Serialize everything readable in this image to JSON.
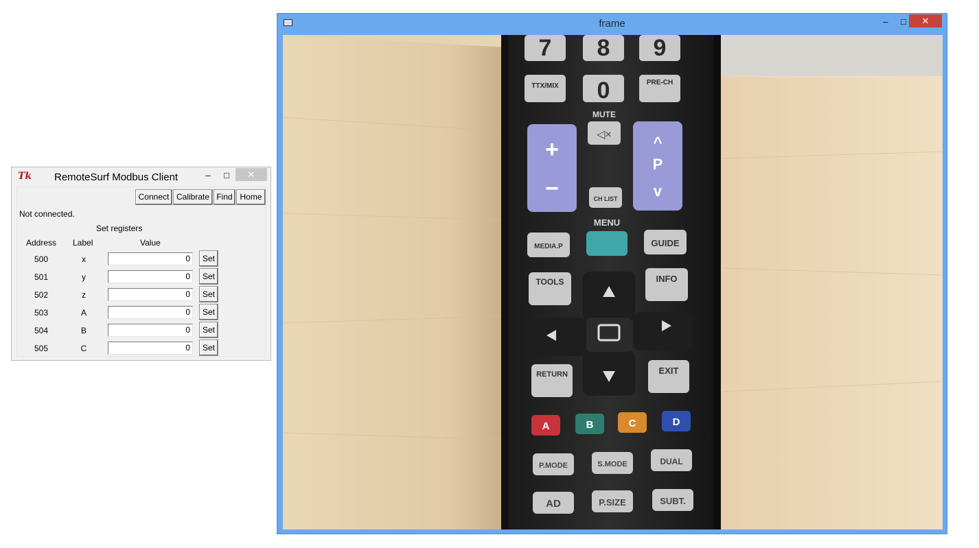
{
  "tk_window": {
    "title": "RemoteSurf Modbus Client",
    "logo": "Tk",
    "controls": {
      "minimize": "–",
      "maximize": "□",
      "close": "✕"
    },
    "toolbar": [
      "Connect",
      "Calibrate",
      "Find",
      "Home"
    ],
    "status": "Not connected.",
    "registers_title": "Set registers",
    "headers": {
      "address": "Address",
      "label": "Label",
      "value": "Value"
    },
    "rows": [
      {
        "address": "500",
        "label": "x",
        "value": "0",
        "button": "Set"
      },
      {
        "address": "501",
        "label": "y",
        "value": "0",
        "button": "Set"
      },
      {
        "address": "502",
        "label": "z",
        "value": "0",
        "button": "Set"
      },
      {
        "address": "503",
        "label": "A",
        "value": "0",
        "button": "Set"
      },
      {
        "address": "504",
        "label": "B",
        "value": "0",
        "button": "Set"
      },
      {
        "address": "505",
        "label": "C",
        "value": "0",
        "button": "Set"
      }
    ]
  },
  "frame_window": {
    "title": "frame",
    "controls": {
      "minimize": "–",
      "maximize": "□",
      "close": "✕"
    },
    "remote_labels": {
      "num7": "7",
      "num8": "8",
      "num9": "9",
      "num0": "0",
      "ttx": "TTX/MIX",
      "prech": "PRE-CH",
      "mute": "MUTE",
      "chlist": "CH LIST",
      "menu": "MENU",
      "mediap": "MEDIA.P",
      "guide": "GUIDE",
      "tools": "TOOLS",
      "info": "INFO",
      "return": "RETURN",
      "exit": "EXIT",
      "a": "A",
      "b": "B",
      "c": "C",
      "d": "D",
      "pmode": "P.MODE",
      "smode": "S.MODE",
      "dual": "DUAL",
      "ad": "AD",
      "psize": "P.SIZE",
      "subt": "SUBT.",
      "p": "P"
    },
    "colors": {
      "red": "#c8323a",
      "green": "#2f7d6e",
      "yellow": "#d98a2e",
      "blue": "#2f4fb0",
      "volume": "#9a9ad8",
      "menu_key": "#3fa7a8"
    }
  }
}
